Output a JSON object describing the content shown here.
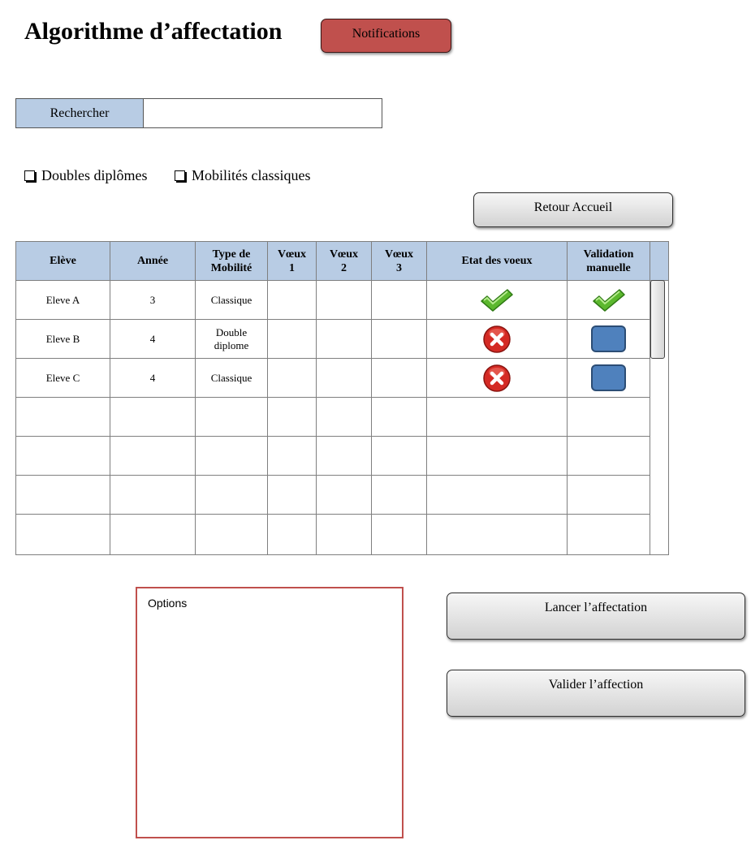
{
  "page": {
    "title": "Algorithme d’affectation",
    "notifications_label": "Notifications"
  },
  "search": {
    "label": "Rechercher",
    "value": ""
  },
  "filters": [
    {
      "label": "Doubles diplômes",
      "checked": false
    },
    {
      "label": "Mobilités classiques",
      "checked": false
    }
  ],
  "buttons": {
    "retour": "Retour Accueil",
    "lancer": "Lancer l’affectation",
    "valider": "Valider l’affection"
  },
  "table": {
    "headers": {
      "eleve": "Elève",
      "annee": "Année",
      "type_a": "Type de",
      "type_b": "Mobilité",
      "voeux1_a": "Vœux",
      "voeux1_b": "1",
      "voeux2_a": "Vœux",
      "voeux2_b": "2",
      "voeux3_a": "Vœux",
      "voeux3_b": "3",
      "etat": "Etat des voeux",
      "validation_a": "Validation",
      "validation_b": "manuelle"
    },
    "rows": [
      {
        "eleve": "Eleve A",
        "annee": "3",
        "type_a": "Classique",
        "type_b": "",
        "voeux1": "",
        "voeux2": "",
        "voeux3": "",
        "etat_icon": "check-icon",
        "validation_icon": "check-icon"
      },
      {
        "eleve": "Eleve B",
        "annee": "4",
        "type_a": "Double",
        "type_b": "diplome",
        "voeux1": "",
        "voeux2": "",
        "voeux3": "",
        "etat_icon": "error-icon",
        "validation_icon": "blue-square-button"
      },
      {
        "eleve": "Eleve C",
        "annee": "4",
        "type_a": "Classique",
        "type_b": "",
        "voeux1": "",
        "voeux2": "",
        "voeux3": "",
        "etat_icon": "error-icon",
        "validation_icon": "blue-square-button"
      }
    ]
  },
  "options": {
    "label": "Options"
  },
  "colors": {
    "header_blue": "#b8cce4",
    "notif_red": "#c0504d",
    "validation_blue": "#4f81bd",
    "check_green": "#5cb82e",
    "error_red": "#d42a24"
  }
}
